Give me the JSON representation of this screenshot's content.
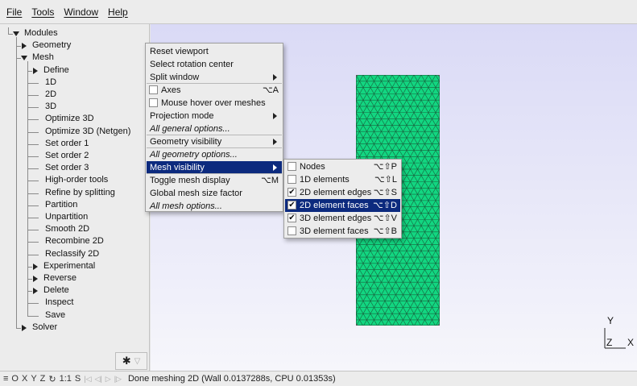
{
  "menubar": {
    "items": [
      {
        "label": "File"
      },
      {
        "label": "Tools"
      },
      {
        "label": "Window"
      },
      {
        "label": "Help"
      }
    ]
  },
  "tree": {
    "modules": "Modules",
    "geometry": "Geometry",
    "mesh": "Mesh",
    "mesh_children": [
      "Define",
      "1D",
      "2D",
      "3D",
      "Optimize 3D",
      "Optimize 3D (Netgen)",
      "Set order 1",
      "Set order 2",
      "Set order 3",
      "High-order tools",
      "Refine by splitting",
      "Partition",
      "Unpartition",
      "Smooth 2D",
      "Recombine 2D",
      "Reclassify 2D",
      "Experimental",
      "Reverse",
      "Delete",
      "Inspect",
      "Save"
    ],
    "solver": "Solver"
  },
  "gear_button": {
    "icon": "gear-icon",
    "filter_icon": "filter-icon"
  },
  "context_menu": {
    "items": [
      {
        "label": "Reset viewport"
      },
      {
        "label": "Select rotation center"
      },
      {
        "label": "Split window"
      },
      {
        "label": "Axes",
        "shortcut": "⌥A",
        "checked": false
      },
      {
        "label": "Mouse hover over meshes",
        "checked": false
      },
      {
        "label": "Projection mode"
      },
      {
        "label": "All general options..."
      },
      {
        "label": "Geometry visibility"
      },
      {
        "label": "All geometry options..."
      },
      {
        "label": "Mesh visibility"
      },
      {
        "label": "Toggle mesh display",
        "shortcut": "⌥M"
      },
      {
        "label": "Global mesh size factor"
      },
      {
        "label": "All mesh options..."
      }
    ]
  },
  "mesh_submenu": {
    "items": [
      {
        "label": "Nodes",
        "shortcut": "⌥⇧P",
        "checked": false
      },
      {
        "label": "1D elements",
        "shortcut": "⌥⇧L",
        "checked": false
      },
      {
        "label": "2D element edges",
        "shortcut": "⌥⇧S",
        "checked": true
      },
      {
        "label": "2D element faces",
        "shortcut": "⌥⇧D",
        "checked": true
      },
      {
        "label": "3D element edges",
        "shortcut": "⌥⇧V",
        "checked": true
      },
      {
        "label": "3D element faces",
        "shortcut": "⌥⇧B",
        "checked": false
      }
    ]
  },
  "axes": {
    "y": "Y",
    "z": "Z",
    "x": "X"
  },
  "statusbar": {
    "controls": [
      "≡",
      "O",
      "X",
      "Y",
      "Z",
      "↻",
      "1:1",
      "S"
    ],
    "anim_controls": [
      "|◁",
      "◁|",
      "▷",
      "|▷"
    ],
    "message": "Done meshing 2D (Wall 0.0137288s, CPU 0.01353s)"
  },
  "colors": {
    "mesh_face": "#12d681",
    "mesh_edge": "#1b4d33",
    "selection": "#0c2a7e"
  }
}
